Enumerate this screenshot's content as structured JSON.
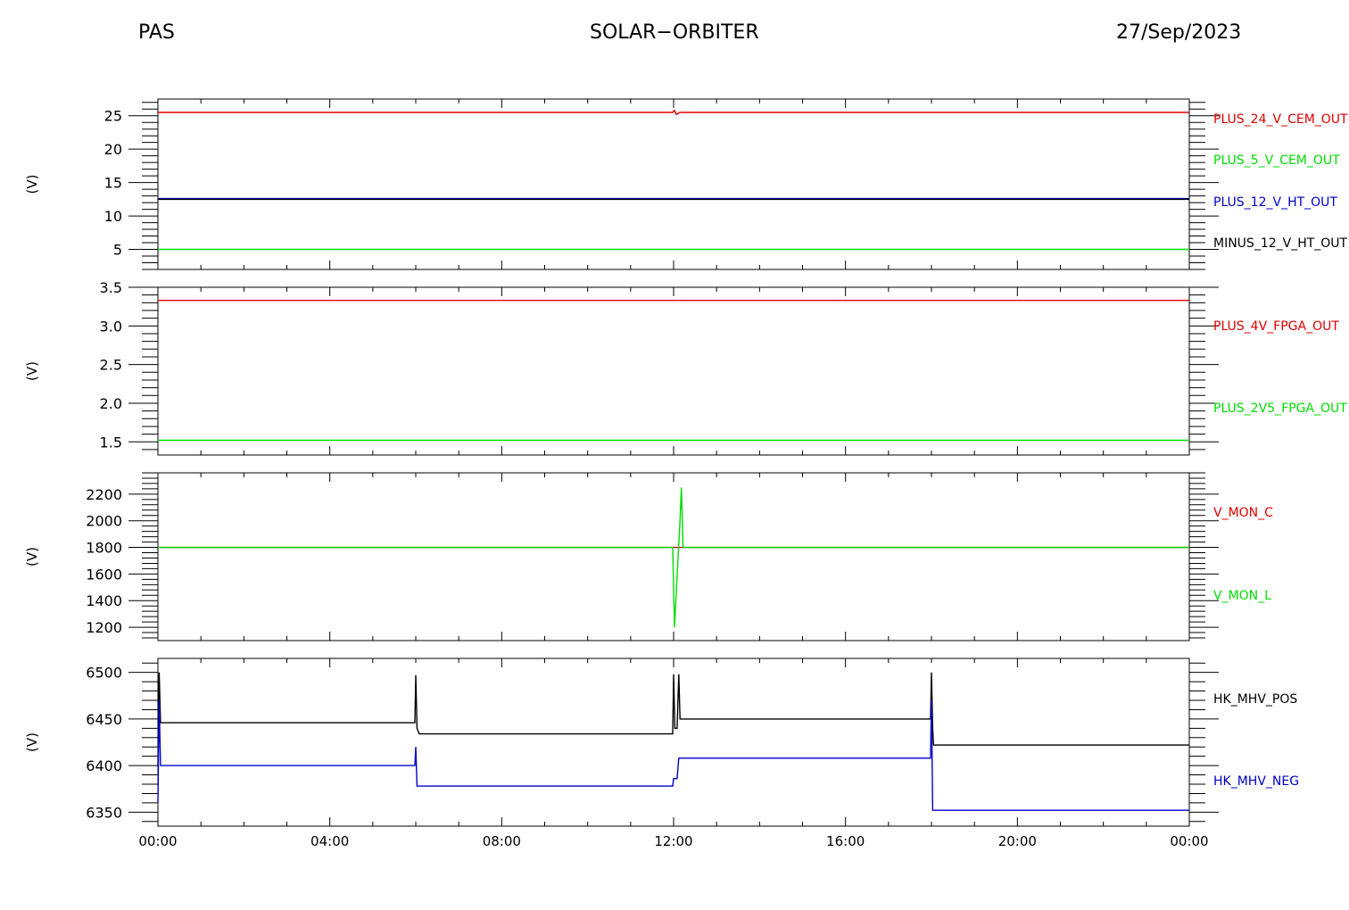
{
  "header": {
    "left": "PAS",
    "center": "SOLAR−ORBITER",
    "right": "27/Sep/2023"
  },
  "chart_data": [
    {
      "type": "line",
      "ylabel": "(V)",
      "ylim": [
        2,
        27.5
      ],
      "yticks": [
        5,
        10,
        15,
        20,
        25
      ],
      "ytick_labels": [
        "5",
        "10",
        "15",
        "20",
        "25"
      ],
      "xlim": [
        0,
        24
      ],
      "series": [
        {
          "name": "PLUS_24_V_CEM_OUT",
          "color": "#e00000",
          "x": [
            0,
            11.98,
            12.02,
            12.06,
            12.1,
            12.14,
            24
          ],
          "y": [
            25.5,
            25.5,
            25.8,
            25.2,
            25.3,
            25.5,
            25.5
          ]
        },
        {
          "name": "PLUS_5_V_CEM_OUT",
          "color": "#00dd00",
          "x": [
            0,
            24
          ],
          "y": [
            5.0,
            5.0
          ]
        },
        {
          "name": "PLUS_12_V_HT_OUT",
          "color": "#0000cc",
          "x": [
            0,
            24
          ],
          "y": [
            12.6,
            12.6
          ]
        },
        {
          "name": "MINUS_12_V_HT_OUT",
          "color": "#000000",
          "x": [
            0,
            24
          ],
          "y": [
            12.5,
            12.5
          ]
        }
      ]
    },
    {
      "type": "line",
      "ylabel": "(V)",
      "ylim": [
        1.33,
        3.5
      ],
      "yticks": [
        1.5,
        2.0,
        2.5,
        3.0,
        3.5
      ],
      "ytick_labels": [
        "1.5",
        "2.0",
        "2.5",
        "3.0",
        "3.5"
      ],
      "xlim": [
        0,
        24
      ],
      "series": [
        {
          "name": "PLUS_4V_FPGA_OUT",
          "color": "#e00000",
          "x": [
            0,
            24
          ],
          "y": [
            3.33,
            3.33
          ]
        },
        {
          "name": "PLUS_2V5_FPGA_OUT",
          "color": "#00dd00",
          "x": [
            0,
            24
          ],
          "y": [
            1.52,
            1.52
          ]
        }
      ]
    },
    {
      "type": "line",
      "ylabel": "(V)",
      "ylim": [
        1100,
        2360
      ],
      "yticks": [
        1200,
        1400,
        1600,
        1800,
        2000,
        2200
      ],
      "ytick_labels": [
        "1200",
        "1400",
        "1600",
        "1800",
        "2000",
        "2200"
      ],
      "xlim": [
        0,
        24
      ],
      "series": [
        {
          "name": "V_MON_C",
          "color": "#e00000",
          "x": [
            0,
            24
          ],
          "y": [
            1800,
            1800
          ]
        },
        {
          "name": "V_MON_L",
          "color": "#00dd00",
          "x": [
            0,
            11.98,
            12.02,
            12.1,
            12.15,
            12.18,
            12.22,
            24
          ],
          "y": [
            1800,
            1800,
            1200,
            1700,
            2000,
            2250,
            1800,
            1800
          ]
        }
      ]
    },
    {
      "type": "line",
      "ylabel": "(V)",
      "ylim": [
        6335,
        6515
      ],
      "yticks": [
        6350,
        6400,
        6450,
        6500
      ],
      "ytick_labels": [
        "6350",
        "6400",
        "6450",
        "6500"
      ],
      "xlim": [
        0,
        24
      ],
      "xticks": [
        0,
        4,
        8,
        12,
        16,
        20,
        24
      ],
      "xtick_labels": [
        "00:00",
        "04:00",
        "08:00",
        "12:00",
        "16:00",
        "20:00",
        "00:00"
      ],
      "series": [
        {
          "name": "HK_MHV_POS",
          "color": "#000000",
          "x": [
            0,
            0.03,
            0.06,
            0.1,
            5.98,
            6.0,
            6.03,
            6.08,
            6.1,
            11.98,
            12.0,
            12.03,
            12.08,
            12.12,
            12.15,
            12.17,
            12.2,
            17.98,
            18.0,
            18.03,
            18.05,
            18.08,
            24
          ],
          "y": [
            6400,
            6500,
            6446,
            6446,
            6446,
            6497,
            6440,
            6434,
            6434,
            6434,
            6498,
            6440,
            6440,
            6498,
            6450,
            6450,
            6450,
            6450,
            6500,
            6440,
            6422,
            6422,
            6422
          ]
        },
        {
          "name": "HK_MHV_NEG",
          "color": "#0000cc",
          "x": [
            0,
            0.03,
            0.06,
            0.1,
            5.98,
            6.0,
            6.03,
            6.08,
            6.1,
            11.98,
            12.0,
            12.03,
            12.08,
            12.12,
            12.15,
            12.17,
            12.2,
            17.98,
            18.0,
            18.03,
            18.05,
            18.08,
            24
          ],
          "y": [
            6360,
            6470,
            6400,
            6400,
            6400,
            6420,
            6378,
            6378,
            6378,
            6378,
            6386,
            6386,
            6386,
            6408,
            6408,
            6408,
            6408,
            6408,
            6470,
            6352,
            6352,
            6352,
            6352
          ]
        }
      ]
    }
  ]
}
